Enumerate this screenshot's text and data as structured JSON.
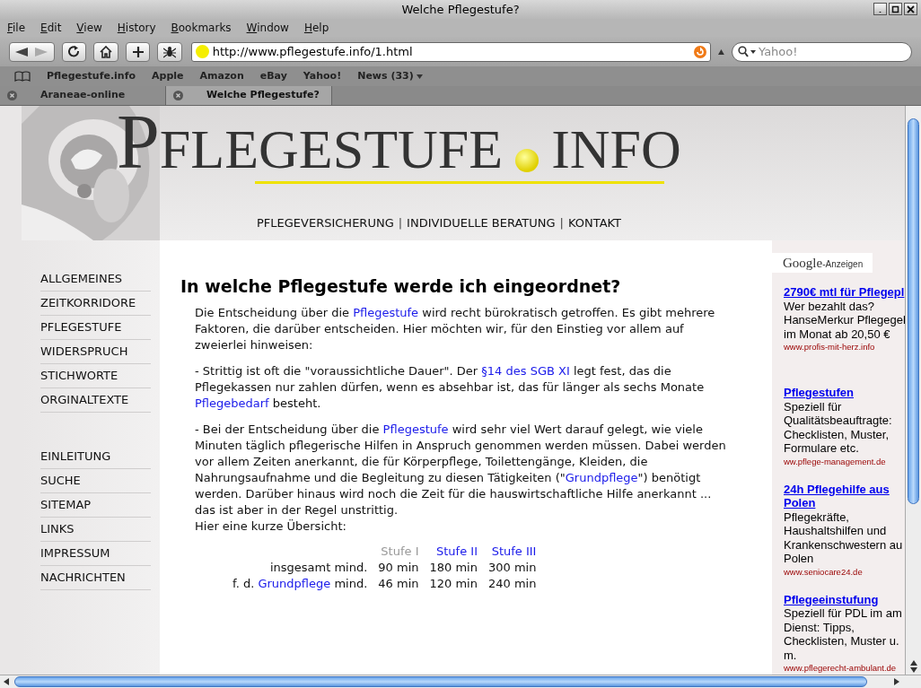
{
  "window": {
    "title": "Welche Pflegestufe?"
  },
  "menu": [
    "File",
    "Edit",
    "View",
    "History",
    "Bookmarks",
    "Window",
    "Help"
  ],
  "address_bar": {
    "value": "http://www.pflegestufe.info/1.html"
  },
  "search": {
    "placeholder": "Yahoo!"
  },
  "bookmarks": [
    {
      "label": "Pflegestufe.info",
      "kind": "link"
    },
    {
      "label": "Apple",
      "kind": "link"
    },
    {
      "label": "Amazon",
      "kind": "link"
    },
    {
      "label": "eBay",
      "kind": "link"
    },
    {
      "label": "Yahoo!",
      "kind": "link"
    },
    {
      "label": "News (33)",
      "kind": "folder"
    }
  ],
  "tabs": [
    {
      "label": "Araneae-online",
      "selected": false
    },
    {
      "label": "Welche Pflegestufe?",
      "selected": true
    }
  ],
  "header": {
    "logo": "PFLEGESTUFE",
    "logo_suffix": "INFO",
    "nav": [
      {
        "kind": "link",
        "text": "PFLEGEVERSICHERUNG"
      },
      {
        "kind": "separator",
        "text": "|"
      },
      {
        "kind": "link",
        "text": "INDIVIDUELLE BERATUNG"
      },
      {
        "kind": "separator",
        "text": "|"
      },
      {
        "kind": "link",
        "text": "KONTAKT"
      }
    ]
  },
  "sidebar": {
    "groups": [
      [
        "ALLGEMEINES",
        "ZEITKORRIDORE",
        "PFLEGESTUFE",
        "WIDERSPRUCH",
        "STICHWORTE",
        "ORGINALTEXTE"
      ],
      [
        "EINLEITUNG",
        "SUCHE",
        "SITEMAP",
        "LINKS",
        "IMPRESSUM",
        "NACHRICHTEN"
      ]
    ]
  },
  "article": {
    "heading": "In welche Pflegestufe werde ich eingeordnet?",
    "paragraphs": [
      [
        {
          "text": "Die Entscheidung über die ",
          "kind": "text"
        },
        {
          "text": "Pflegestufe",
          "kind": "link"
        },
        {
          "text": " wird recht bürokratisch getroffen. Es gibt mehrere Faktoren, die darüber entscheiden. Hier möchten wir, für den Einstieg vor allem auf zweierlei hinweisen:",
          "kind": "text"
        }
      ],
      [
        {
          "text": "- Strittig ist oft die \"voraussichtliche Dauer\". Der ",
          "kind": "text"
        },
        {
          "text": "§14 des SGB XI",
          "kind": "link"
        },
        {
          "text": " legt fest, das die Pflegekassen nur zahlen dürfen, wenn es absehbar ist, das für länger als sechs Monate ",
          "kind": "text"
        },
        {
          "text": "Pflegebedarf",
          "kind": "link"
        },
        {
          "text": " besteht.",
          "kind": "text"
        }
      ],
      [
        {
          "text": "- Bei der Entscheidung über die ",
          "kind": "text"
        },
        {
          "text": "Pflegestufe",
          "kind": "link"
        },
        {
          "text": " wird sehr viel Wert darauf gelegt, wie viele Minuten täglich pflegerische Hilfen in Anspruch genommen werden müssen. Dabei werden vor allem Zeiten anerkannt, die für Körperpflege, Toilettengänge, Kleiden, die Nahrungsaufnahme und die Begleitung zu diesen Tätigkeiten (\"",
          "kind": "text"
        },
        {
          "text": "Grundpflege",
          "kind": "link"
        },
        {
          "text": "\") benötigt werden. Darüber hinaus wird noch die Zeit für die hauswirtschaftliche Hilfe anerkannt ... das ist aber in der Regel unstrittig.",
          "kind": "text"
        }
      ]
    ],
    "intro": "Hier eine kurze Übersicht:",
    "table": {
      "columns": [
        {
          "label": "Stufe I",
          "kind": "current"
        },
        {
          "label": "Stufe II",
          "kind": "link"
        },
        {
          "label": "Stufe III",
          "kind": "link"
        }
      ],
      "rows": [
        {
          "label": [
            {
              "text": "insgesamt mind.",
              "kind": "text"
            }
          ],
          "cells": [
            "90 min",
            "180 min",
            "300 min"
          ]
        },
        {
          "label": [
            {
              "text": "f. d. ",
              "kind": "text"
            },
            {
              "text": "Grundpflege",
              "kind": "link"
            },
            {
              "text": " mind.",
              "kind": "text"
            }
          ],
          "cells": [
            "46 min",
            "120 min",
            "240 min"
          ]
        }
      ]
    }
  },
  "ads": {
    "brand": "Google",
    "label": "-Anzeigen",
    "items": [
      {
        "title": "2790€ mtl für Pflegepl",
        "body": [
          "Wer bezahlt das?",
          "HanseMerkur Pflegegel",
          "im Monat ab 20,50 €"
        ],
        "url": "www.profis-mit-herz.info"
      },
      {
        "title": "Pflegestufen",
        "body": [
          "Speziell für",
          "Qualitätsbeauftragte:",
          "Checklisten, Muster,",
          "Formulare etc."
        ],
        "url": "ww.pflege-management.de"
      },
      {
        "title": "24h Pflegehilfe aus Polen",
        "body": [
          "Pflegekräfte,",
          "Haushaltshilfen und",
          "Krankenschwestern au",
          "Polen"
        ],
        "url": "www.seniocare24.de"
      },
      {
        "title": "Pflegeeinstufung",
        "body": [
          "Speziell für PDL im am",
          "Dienst: Tipps,",
          "Checklisten, Muster u.",
          "m."
        ],
        "url": "www.pflegerecht-ambulant.de"
      }
    ]
  }
}
